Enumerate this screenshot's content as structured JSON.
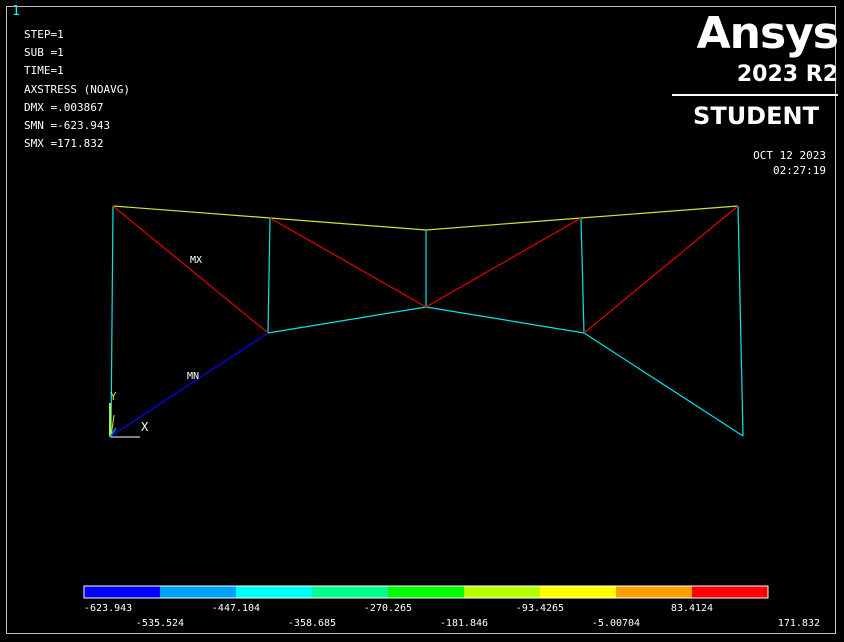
{
  "window_number": "1",
  "info": {
    "step": "STEP=1",
    "sub": "SUB =1",
    "time": "TIME=1",
    "result": "AXSTRESS (NOAVG)",
    "dmx": "DMX =.003867",
    "smn": "SMN =-623.943",
    "smx": "SMX =171.832"
  },
  "brand": {
    "logo": "Ansys",
    "version": "2023 R2",
    "edition": "STUDENT"
  },
  "datetime": {
    "date": "OCT 12 2023",
    "time": "02:27:19"
  },
  "labels": {
    "max": "MX",
    "min": "MN",
    "axis_x": "X",
    "axis_y": "Y"
  },
  "legend": {
    "colors": [
      "#0000ff",
      "#00a0ff",
      "#00ffff",
      "#00ff90",
      "#00ff00",
      "#b4ff00",
      "#ffff00",
      "#ffa000",
      "#ff0000"
    ],
    "ticks": [
      "-623.943",
      "-535.524",
      "-447.104",
      "-358.685",
      "-270.265",
      "-181.846",
      "-93.4265",
      "-5.00704",
      "83.4124",
      "171.832"
    ]
  },
  "truss_colors": {
    "top_chord": "#c8e632",
    "diagonal_top": "#e60000",
    "diagonal_bottom": "#0000ff",
    "members": "#00e6e6"
  }
}
